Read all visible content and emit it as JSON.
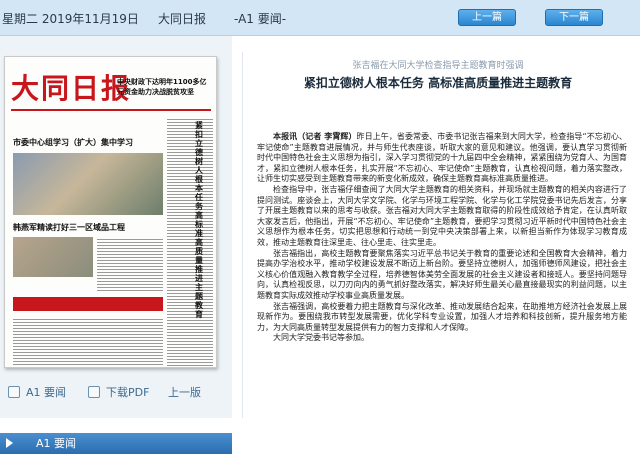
{
  "topbar": {
    "date": "星期二 2019年11月19日",
    "paper_name": "大同日报",
    "page_label": "-A1 要闻-",
    "prev_label": "上一篇",
    "next_label": "下一篇"
  },
  "thumbnail": {
    "masthead": "大同日报",
    "side_headline": "中央财政下达明年1100多亿元资金助力决战脱贫攻坚",
    "headline_main": "市委中心组学习（扩大）集中学习",
    "headline_second": "韩燕军精读打好三一区域品工程",
    "vertical_headline": "紧扣立德树人根本任务高标准高质量推进主题教育"
  },
  "bottom_links": {
    "page_link": "A1 要闻",
    "pdf_link": "下载PDF",
    "prev_page": "上一版"
  },
  "page_tab": "A1 要闻",
  "article": {
    "subtitle": "张吉福在大同大学检查指导主题教育时强调",
    "title": "紧扣立德树人根本任务 高标准高质量推进主题教育",
    "lead": "本报讯（记者 李霄辉）",
    "paragraphs": [
      "昨日上午，省委常委、市委书记张吉福来到大同大学，检查指导“不忘初心、牢记使命”主题教育进展情况，并与师生代表座谈，听取大家的意见和建议。他强调，要认真学习贯彻新时代中国特色社会主义思想为指引，深入学习贯彻党的十九届四中全会精神，紧紧围绕为党育人、为国育才，紧扣立德树人根本任务，扎实开展“不忘初心、牢记使命”主题教育，认真检视问题，着力落实整改，让师生切实感受到主题教育带来的新变化新成效，确保主题教育高标准高质量推进。",
      "检查指导中，张吉福仔细查阅了大同大学主题教育的相关资料，并现场就主题教育的相关内容进行了提问测试。座谈会上，大同大学文学院、化学与环境工程学院、化学与化工学院党委书记先后发言，分享了开展主题教育以来的思考与收获。张吉福对大同大学主题教育取得的阶段性成效给予肯定，在认真听取大家发言后，他指出，开展“不忘初心、牢记使命”主题教育，要把学习贯彻习近平新时代中国特色社会主义思想作为根本任务，切实把思想和行动统一到党中央决策部署上来，以新担当新作为体现学习教育成效，推动主题教育往深里走、往心里走、往实里走。",
      "张吉福指出，高校主题教育要聚焦落实习近平总书记关于教育的重要论述和全国教育大会精神，着力提高办学治校水平，推动学校建设发展不断迈上新台阶。要坚持立德树人，加强师德师风建设，把社会主义核心价值观融入教育教学全过程，培养德智体美劳全面发展的社会主义建设者和接班人。要坚持问题导向，认真检视反思，以刀刃向内的勇气抓好整改落实，解决好师生最关心最直接最现实的利益问题，以主题教育实际成效推动学校事业高质量发展。",
      "张吉福强调，高校要着力把主题教育与深化改革、推动发展结合起来，在助推地方经济社会发展上展现新作为。要围绕我市转型发展需要，优化学科专业设置，加强人才培养和科技创新，提升服务地方能力，为大同高质量转型发展提供有力的智力支撑和人才保障。",
      "大同大学党委书记等参加。"
    ]
  }
}
